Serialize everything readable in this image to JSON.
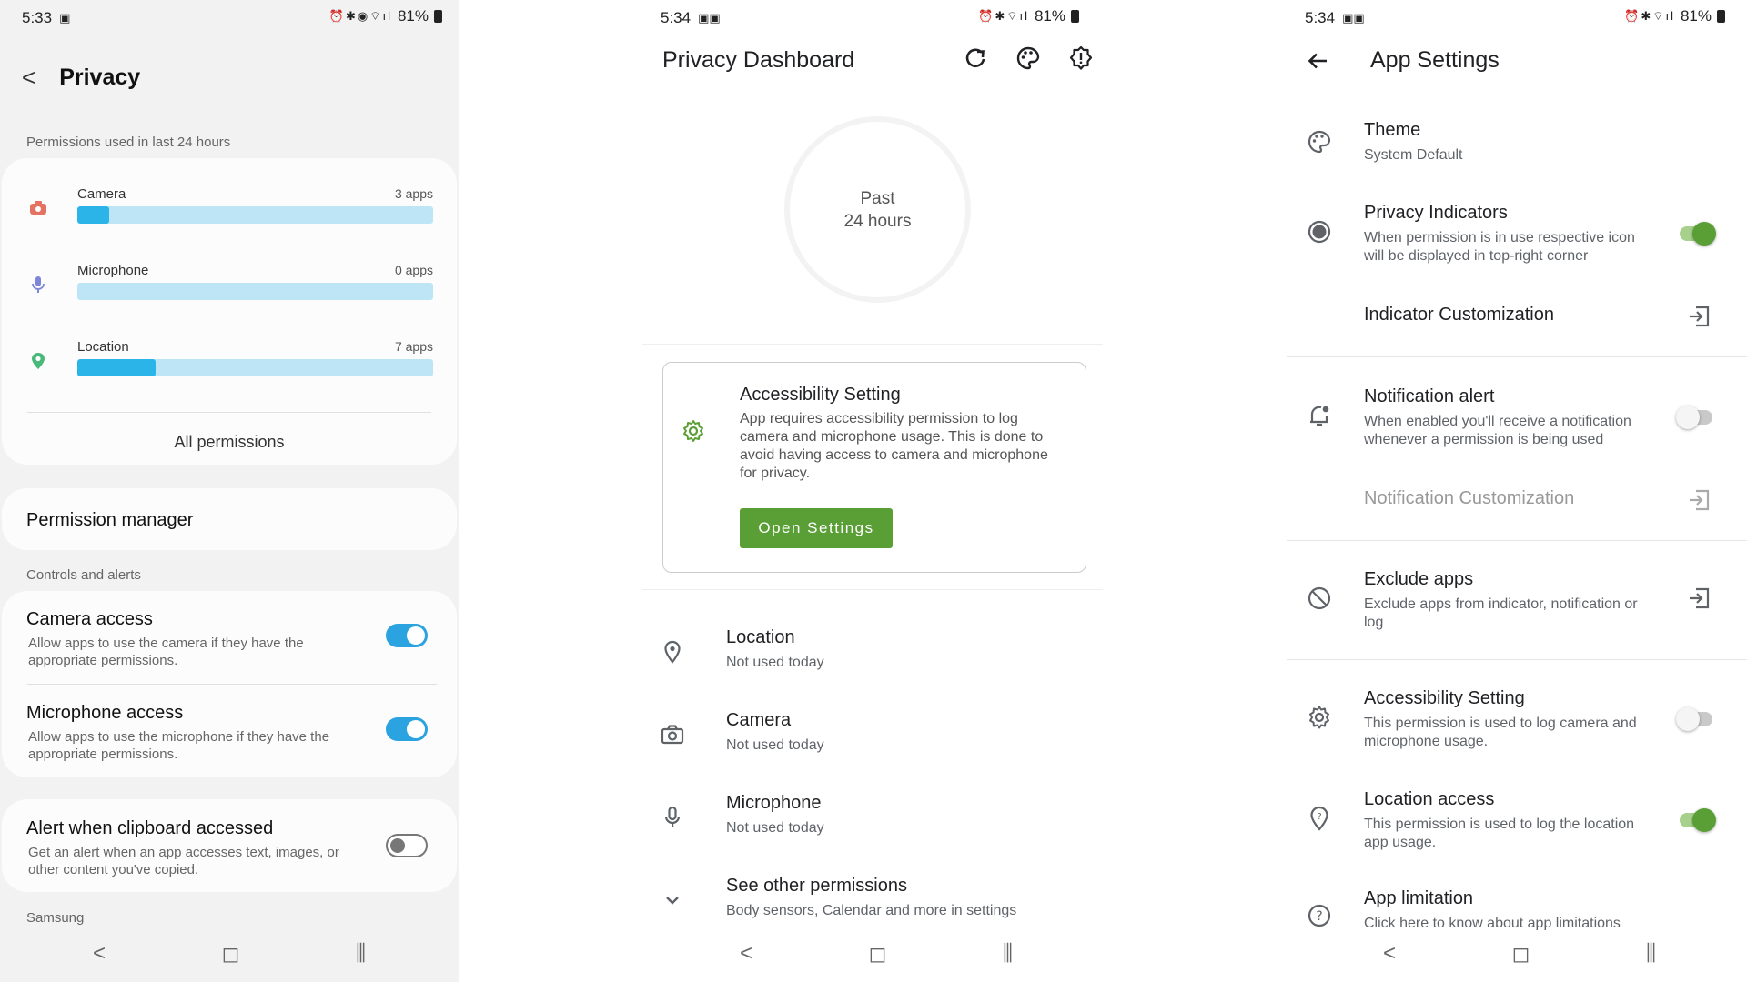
{
  "left": {
    "status": {
      "time": "5:33",
      "battery": "81%"
    },
    "title": "Privacy",
    "section_permissions": "Permissions used in last 24 hours",
    "permissions": [
      {
        "name": "Camera",
        "count": "3 apps",
        "fraction": 0.09,
        "icon": "camera-icon",
        "color": "#e57363"
      },
      {
        "name": "Microphone",
        "count": "0 apps",
        "fraction": 0.0,
        "icon": "microphone-icon",
        "color": "#7d86d8"
      },
      {
        "name": "Location",
        "count": "7 apps",
        "fraction": 0.22,
        "icon": "location-pin-icon",
        "color": "#49b878"
      }
    ],
    "all_permissions": "All permissions",
    "permission_manager": "Permission manager",
    "section_controls": "Controls and alerts",
    "camera_access": {
      "title": "Camera access",
      "desc": "Allow apps to use the camera if they have the appropriate permissions.",
      "on": true
    },
    "microphone_access": {
      "title": "Microphone access",
      "desc": "Allow apps to use the microphone if they have the appropriate permissions.",
      "on": true
    },
    "clipboard": {
      "title": "Alert when clipboard accessed",
      "desc": "Get an alert when an app accesses text, images, or other content you've copied.",
      "on": false
    },
    "section_samsung": "Samsung"
  },
  "mid": {
    "status": {
      "time": "5:34",
      "battery": "81%"
    },
    "title": "Privacy Dashboard",
    "ring_line1": "Past",
    "ring_line2": "24 hours",
    "accessibility_card": {
      "title": "Accessibility Setting",
      "desc": "App requires accessibility permission to log camera and microphone usage. This is done to avoid having access to camera and microphone for privacy.",
      "button": "Open Settings"
    },
    "rows": [
      {
        "title": "Location",
        "sub": "Not used today",
        "icon": "location-pin-icon"
      },
      {
        "title": "Camera",
        "sub": "Not used today",
        "icon": "camera-icon"
      },
      {
        "title": "Microphone",
        "sub": "Not used today",
        "icon": "microphone-icon"
      },
      {
        "title": "See other permissions",
        "sub": "Body sensors, Calendar and more in settings",
        "icon": "chevron-down-icon"
      }
    ],
    "accent": "#5a9f35"
  },
  "right": {
    "status": {
      "time": "5:34",
      "battery": "81%"
    },
    "title": "App Settings",
    "theme": {
      "title": "Theme",
      "sub": "System Default"
    },
    "privacy_indicators": {
      "title": "Privacy Indicators",
      "sub": "When permission is in use respective icon will be displayed in top-right corner",
      "on": true
    },
    "indicator_customization": "Indicator Customization",
    "notification_alert": {
      "title": "Notification alert",
      "sub": "When enabled you'll receive a notification whenever a permission is being used",
      "on": false
    },
    "notification_customization": "Notification Customization",
    "exclude_apps": {
      "title": "Exclude apps",
      "sub": "Exclude apps from indicator, notification or log"
    },
    "accessibility_setting": {
      "title": "Accessibility Setting",
      "sub": "This permission is used to log camera and microphone usage.",
      "on": false
    },
    "location_access": {
      "title": "Location access",
      "sub": "This permission is used to log the location app usage.",
      "on": true
    },
    "app_limitation": {
      "title": "App limitation",
      "sub": "Click here to know about app limitations"
    }
  }
}
